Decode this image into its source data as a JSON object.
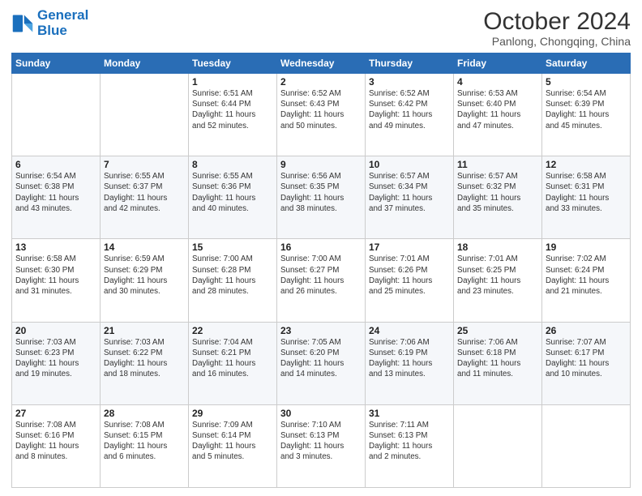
{
  "header": {
    "logo_line1": "General",
    "logo_line2": "Blue",
    "month_title": "October 2024",
    "subtitle": "Panlong, Chongqing, China"
  },
  "weekdays": [
    "Sunday",
    "Monday",
    "Tuesday",
    "Wednesday",
    "Thursday",
    "Friday",
    "Saturday"
  ],
  "weeks": [
    [
      {
        "day": "",
        "info": ""
      },
      {
        "day": "",
        "info": ""
      },
      {
        "day": "1",
        "info": "Sunrise: 6:51 AM\nSunset: 6:44 PM\nDaylight: 11 hours\nand 52 minutes."
      },
      {
        "day": "2",
        "info": "Sunrise: 6:52 AM\nSunset: 6:43 PM\nDaylight: 11 hours\nand 50 minutes."
      },
      {
        "day": "3",
        "info": "Sunrise: 6:52 AM\nSunset: 6:42 PM\nDaylight: 11 hours\nand 49 minutes."
      },
      {
        "day": "4",
        "info": "Sunrise: 6:53 AM\nSunset: 6:40 PM\nDaylight: 11 hours\nand 47 minutes."
      },
      {
        "day": "5",
        "info": "Sunrise: 6:54 AM\nSunset: 6:39 PM\nDaylight: 11 hours\nand 45 minutes."
      }
    ],
    [
      {
        "day": "6",
        "info": "Sunrise: 6:54 AM\nSunset: 6:38 PM\nDaylight: 11 hours\nand 43 minutes."
      },
      {
        "day": "7",
        "info": "Sunrise: 6:55 AM\nSunset: 6:37 PM\nDaylight: 11 hours\nand 42 minutes."
      },
      {
        "day": "8",
        "info": "Sunrise: 6:55 AM\nSunset: 6:36 PM\nDaylight: 11 hours\nand 40 minutes."
      },
      {
        "day": "9",
        "info": "Sunrise: 6:56 AM\nSunset: 6:35 PM\nDaylight: 11 hours\nand 38 minutes."
      },
      {
        "day": "10",
        "info": "Sunrise: 6:57 AM\nSunset: 6:34 PM\nDaylight: 11 hours\nand 37 minutes."
      },
      {
        "day": "11",
        "info": "Sunrise: 6:57 AM\nSunset: 6:32 PM\nDaylight: 11 hours\nand 35 minutes."
      },
      {
        "day": "12",
        "info": "Sunrise: 6:58 AM\nSunset: 6:31 PM\nDaylight: 11 hours\nand 33 minutes."
      }
    ],
    [
      {
        "day": "13",
        "info": "Sunrise: 6:58 AM\nSunset: 6:30 PM\nDaylight: 11 hours\nand 31 minutes."
      },
      {
        "day": "14",
        "info": "Sunrise: 6:59 AM\nSunset: 6:29 PM\nDaylight: 11 hours\nand 30 minutes."
      },
      {
        "day": "15",
        "info": "Sunrise: 7:00 AM\nSunset: 6:28 PM\nDaylight: 11 hours\nand 28 minutes."
      },
      {
        "day": "16",
        "info": "Sunrise: 7:00 AM\nSunset: 6:27 PM\nDaylight: 11 hours\nand 26 minutes."
      },
      {
        "day": "17",
        "info": "Sunrise: 7:01 AM\nSunset: 6:26 PM\nDaylight: 11 hours\nand 25 minutes."
      },
      {
        "day": "18",
        "info": "Sunrise: 7:01 AM\nSunset: 6:25 PM\nDaylight: 11 hours\nand 23 minutes."
      },
      {
        "day": "19",
        "info": "Sunrise: 7:02 AM\nSunset: 6:24 PM\nDaylight: 11 hours\nand 21 minutes."
      }
    ],
    [
      {
        "day": "20",
        "info": "Sunrise: 7:03 AM\nSunset: 6:23 PM\nDaylight: 11 hours\nand 19 minutes."
      },
      {
        "day": "21",
        "info": "Sunrise: 7:03 AM\nSunset: 6:22 PM\nDaylight: 11 hours\nand 18 minutes."
      },
      {
        "day": "22",
        "info": "Sunrise: 7:04 AM\nSunset: 6:21 PM\nDaylight: 11 hours\nand 16 minutes."
      },
      {
        "day": "23",
        "info": "Sunrise: 7:05 AM\nSunset: 6:20 PM\nDaylight: 11 hours\nand 14 minutes."
      },
      {
        "day": "24",
        "info": "Sunrise: 7:06 AM\nSunset: 6:19 PM\nDaylight: 11 hours\nand 13 minutes."
      },
      {
        "day": "25",
        "info": "Sunrise: 7:06 AM\nSunset: 6:18 PM\nDaylight: 11 hours\nand 11 minutes."
      },
      {
        "day": "26",
        "info": "Sunrise: 7:07 AM\nSunset: 6:17 PM\nDaylight: 11 hours\nand 10 minutes."
      }
    ],
    [
      {
        "day": "27",
        "info": "Sunrise: 7:08 AM\nSunset: 6:16 PM\nDaylight: 11 hours\nand 8 minutes."
      },
      {
        "day": "28",
        "info": "Sunrise: 7:08 AM\nSunset: 6:15 PM\nDaylight: 11 hours\nand 6 minutes."
      },
      {
        "day": "29",
        "info": "Sunrise: 7:09 AM\nSunset: 6:14 PM\nDaylight: 11 hours\nand 5 minutes."
      },
      {
        "day": "30",
        "info": "Sunrise: 7:10 AM\nSunset: 6:13 PM\nDaylight: 11 hours\nand 3 minutes."
      },
      {
        "day": "31",
        "info": "Sunrise: 7:11 AM\nSunset: 6:13 PM\nDaylight: 11 hours\nand 2 minutes."
      },
      {
        "day": "",
        "info": ""
      },
      {
        "day": "",
        "info": ""
      }
    ]
  ]
}
